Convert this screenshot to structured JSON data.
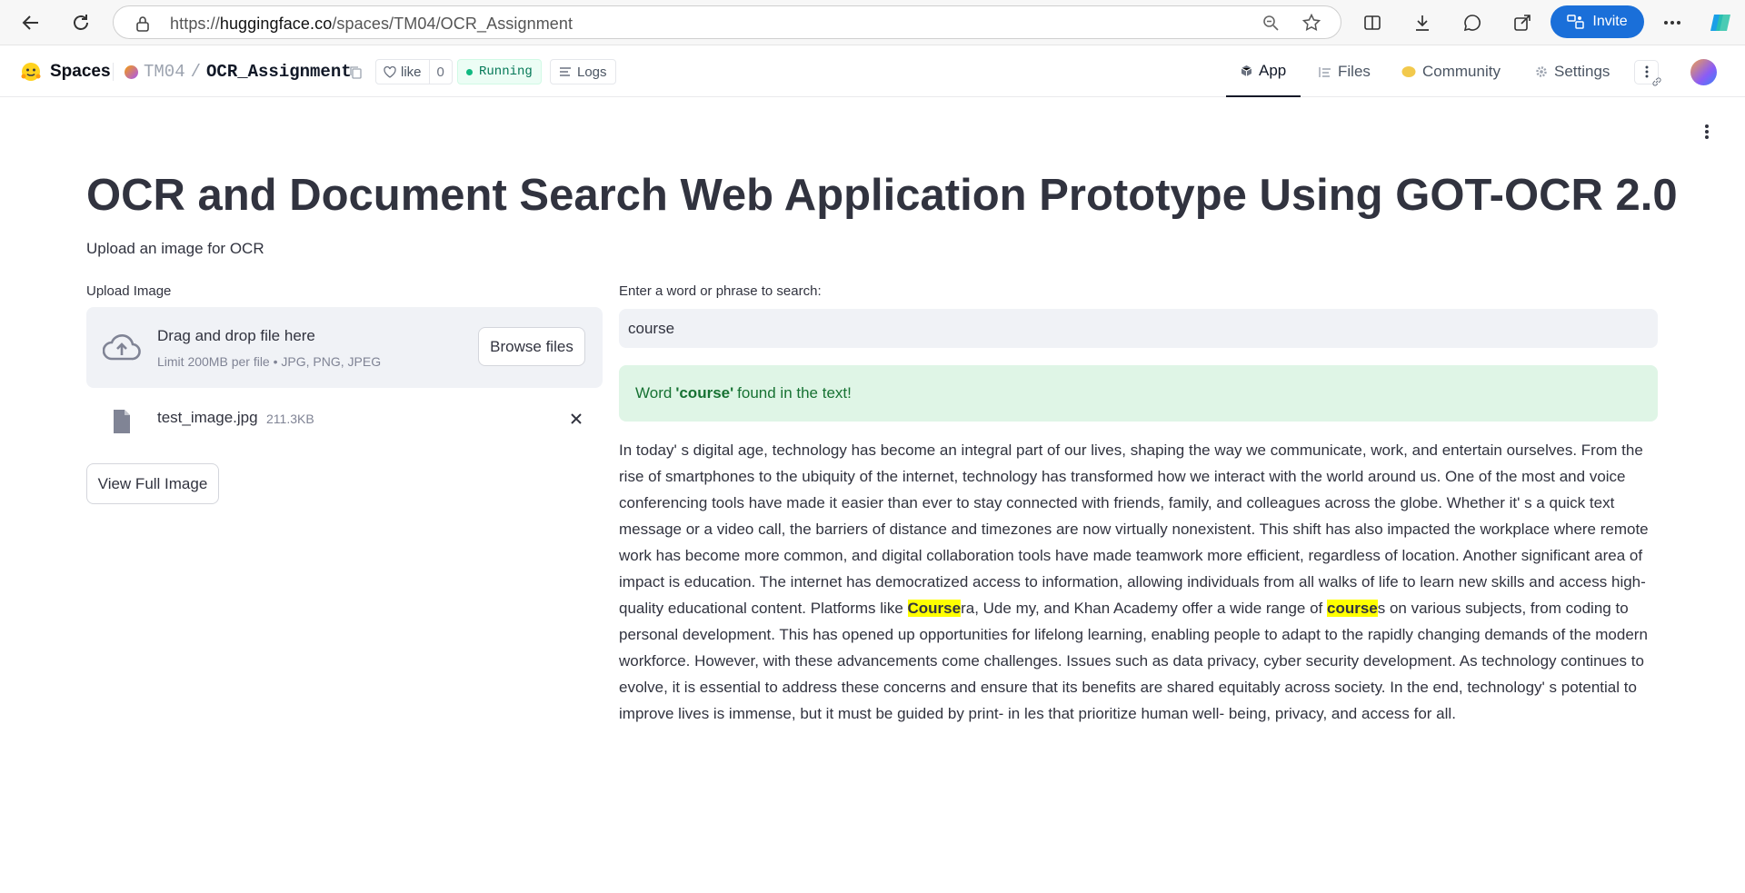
{
  "browser": {
    "url_prefix": "https://",
    "url_domain": "huggingface.co",
    "url_path": "/spaces/TM04/OCR_Assignment",
    "invite_label": "Invite"
  },
  "hf_nav": {
    "spaces_label": "Spaces",
    "owner": "TM04",
    "separator": "/",
    "repo": "OCR_Assignment",
    "like_label": "like",
    "like_count": "0",
    "status": "Running",
    "logs_label": "Logs",
    "tabs": [
      {
        "label": "App",
        "active": true
      },
      {
        "label": "Files",
        "active": false
      },
      {
        "label": "Community",
        "active": false
      },
      {
        "label": "Settings",
        "active": false
      }
    ]
  },
  "app": {
    "title": "OCR and Document Search Web Application Prototype Using GOT-OCR 2.0",
    "subtitle": "Upload an image for OCR",
    "upload_label": "Upload Image",
    "dropzone_main": "Drag and drop file here",
    "dropzone_limit": "Limit 200MB per file • JPG, PNG, JPEG",
    "browse_label": "Browse files",
    "file_name": "test_image.jpg",
    "file_size": "211.3KB",
    "view_full_label": "View Full Image",
    "search_label": "Enter a word or phrase to search:",
    "search_value": "course",
    "alert_prefix": "Word",
    "alert_word": "'course'",
    "alert_suffix": "found in the text!",
    "text_parts": [
      "In today' s digital age, technology has become an integral part of our lives, shaping the way we communicate, work, and entertain ourselves. From the rise of smartphones to the ubiquity of the internet, technology has transformed how we interact with the world around us. One of the most and voice conferencing tools have made it easier than ever to stay connected with friends, family, and colleagues across the globe. Whether it' s a quick text message or a video call, the barriers of distance and timezones are now virtually nonexistent. This shift has also impacted the workplace where remote work has become more common, and digital collaboration tools have made teamwork more efficient, regardless of location. Another significant area of impact is education. The internet has democratized access to information, allowing individuals from all walks of life to learn new skills and access high-quality educational content. Platforms like ",
      "Course",
      "ra, Ude my, and Khan Academy offer a wide range of ",
      "course",
      "s on various subjects, from coding to personal development. This has opened up opportunities for lifelong learning, enabling people to adapt to the rapidly changing demands of the modern workforce. However, with these advancements come challenges. Issues such as data privacy, cyber security development. As technology continues to evolve, it is essential to address these concerns and ensure that its benefits are shared equitably across society. In the end, technology' s potential to improve lives is immense, but it must be guided by print- in les that prioritize human well- being, privacy, and access for all."
    ]
  },
  "colors": {
    "accent_blue": "#1a6fd9",
    "success_bg": "#dff5e6",
    "success_text": "#177233",
    "highlight": "#ffff00"
  }
}
